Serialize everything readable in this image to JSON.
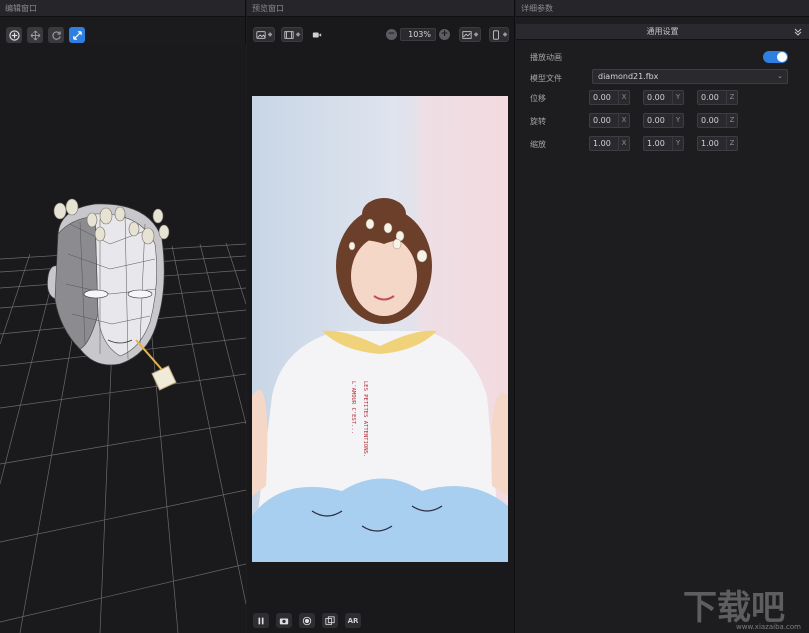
{
  "panels": {
    "left_title": "编辑窗口",
    "mid_title": "预览窗口",
    "right_title": "详细参数"
  },
  "left_toolbar": {
    "icons": [
      "add-icon",
      "move-icon",
      "rotate-icon",
      "scale-icon"
    ],
    "active": "scale-icon"
  },
  "mid_toolbar": {
    "icons": [
      "image-icon",
      "film-icon",
      "video-camera-icon",
      "zoom-out-icon",
      "zoom-in-icon",
      "chart-icon",
      "phone-icon"
    ],
    "zoom": "103%"
  },
  "bottom_bar": {
    "icons": [
      "pause-icon",
      "camera-icon",
      "record-icon",
      "layers-icon"
    ],
    "ar_label": "AR"
  },
  "details": {
    "section": "通用设置",
    "play_animation_label": "播放动画",
    "play_animation_on": true,
    "model_file_label": "模型文件",
    "model_file": "diamond21.fbx",
    "rows": [
      {
        "label": "位移",
        "x": "0.00",
        "y": "0.00",
        "z": "0.00"
      },
      {
        "label": "旋转",
        "x": "0.00",
        "y": "0.00",
        "z": "0.00"
      },
      {
        "label": "缩放",
        "x": "1.00",
        "y": "1.00",
        "z": "1.00"
      }
    ],
    "axes": [
      "X",
      "Y",
      "Z"
    ]
  },
  "preview": {
    "shirt_text_1": "L'AMOUR C'EST...",
    "shirt_text_2": "LES PETITES ATTENTIONS."
  },
  "watermark": {
    "brand": "下载吧",
    "url": "www.xiazaiba.com"
  },
  "colors": {
    "accent": "#2f7fe0",
    "panel_bg": "#1b1b1d"
  }
}
